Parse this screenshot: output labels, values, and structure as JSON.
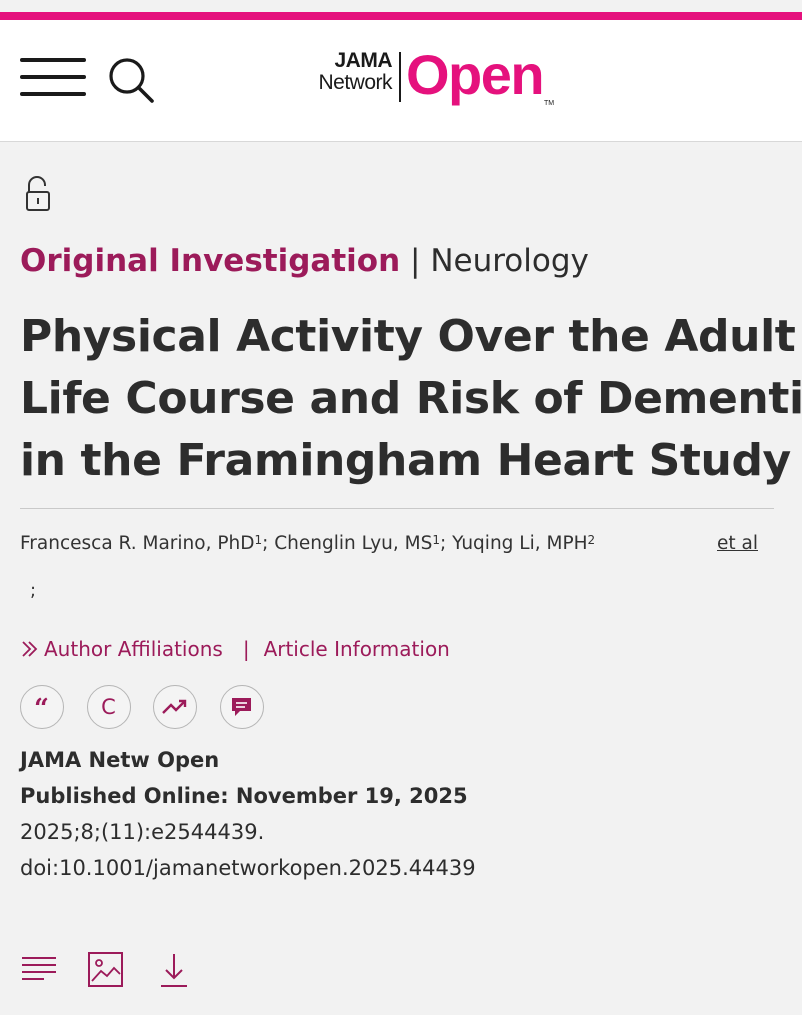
{
  "header": {
    "logo": {
      "line1": "JAMA",
      "line2": "Network",
      "brand": "Open",
      "tm": "TM"
    },
    "menu_icon": "hamburger-menu-icon",
    "search_icon": "search-icon"
  },
  "colors": {
    "brand": "#e5117d",
    "accent": "#9c1b5a",
    "text": "#2d2d2d",
    "background": "#f2f2f2"
  },
  "article": {
    "access_icon": "open-lock-icon",
    "type": "Original Investigation",
    "separator": "|",
    "subject": "Neurology",
    "title_lines": [
      "Physical Activity Over the Adult",
      "Life Course and Risk of Dementia",
      "in the Framingham Heart Study"
    ],
    "authors": [
      {
        "name": "Francesca R. Marino, PhD",
        "aff": "1"
      },
      {
        "name": "Chenglin Lyu, MS",
        "aff": "1"
      },
      {
        "name": "Yuqing Li, MPH",
        "aff": "2"
      }
    ],
    "author_sep": ";",
    "et_al": "et al",
    "trailing": ";",
    "links": {
      "chevron": "»",
      "affiliations": "Author Affiliations",
      "bar": "|",
      "info": "Article Information"
    },
    "tools": [
      {
        "name": "cite-icon",
        "glyph": "“"
      },
      {
        "name": "permissions-icon",
        "glyph": "C"
      },
      {
        "name": "metrics-icon",
        "glyph": ""
      },
      {
        "name": "comments-icon",
        "glyph": ""
      }
    ],
    "journal": "JAMA Netw Open",
    "published": "Published Online: November 19, 2025",
    "citation": "2025;8;(11):e2544439.",
    "doi": "doi:10.1001/jamanetworkopen.2025.44439"
  },
  "bottom_icons": [
    "outline-icon",
    "figures-icon",
    "download-icon"
  ]
}
